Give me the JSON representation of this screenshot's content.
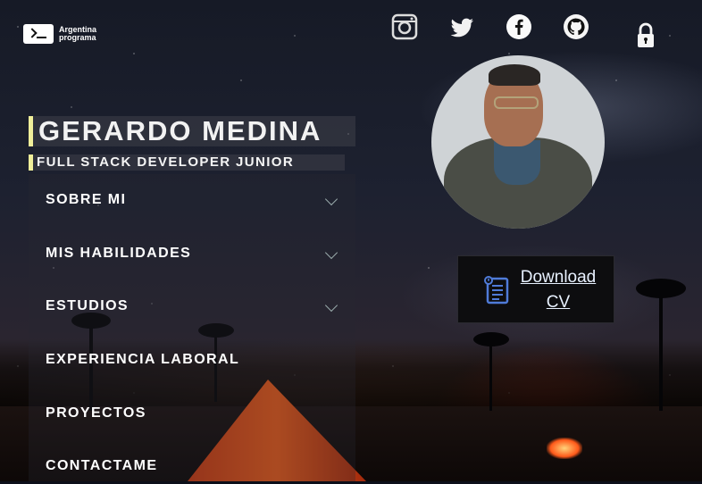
{
  "logo": {
    "line1": "Argentina",
    "line2": "programa"
  },
  "socials": [
    {
      "name": "instagram"
    },
    {
      "name": "twitter"
    },
    {
      "name": "facebook"
    },
    {
      "name": "github"
    },
    {
      "name": "lock"
    }
  ],
  "hero": {
    "name": "GERARDO MEDINA",
    "role": "FULL STACK DEVELOPER JUNIOR"
  },
  "menu": [
    {
      "label": "SOBRE MI",
      "expandable": true
    },
    {
      "label": "MIS HABILIDADES",
      "expandable": true
    },
    {
      "label": "ESTUDIOS",
      "expandable": true
    },
    {
      "label": "EXPERIENCIA LABORAL",
      "expandable": false
    },
    {
      "label": "PROYECTOS",
      "expandable": false
    },
    {
      "label": "CONTACTAME",
      "expandable": false
    }
  ],
  "download": {
    "line1": "Download",
    "line2": "CV"
  },
  "colors": {
    "accent_bar": "#f0ef9a",
    "cv_bg": "#0d0d0f",
    "link_text": "#e8f1ff"
  }
}
